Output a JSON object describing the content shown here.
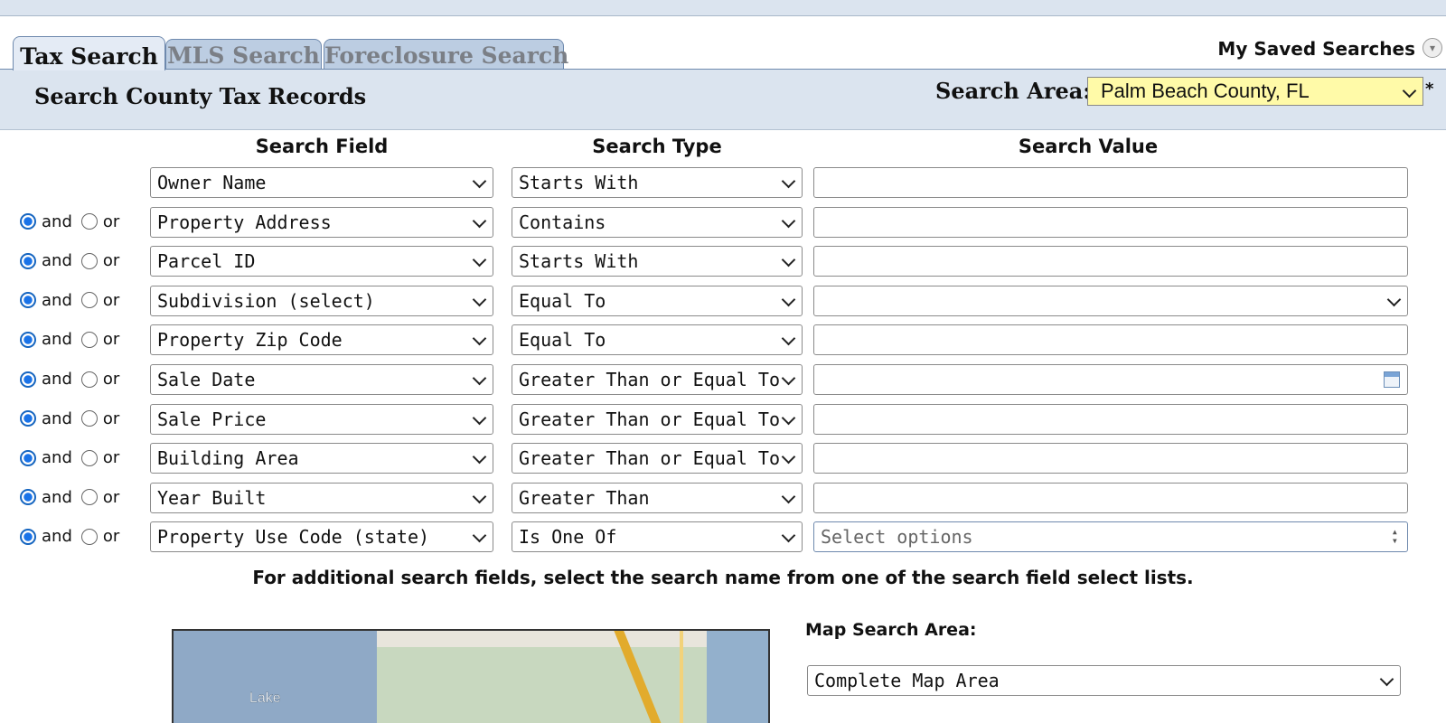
{
  "tabs": [
    {
      "label": "Tax Search",
      "active": true
    },
    {
      "label": "MLS Search",
      "active": false
    },
    {
      "label": "Foreclosure Search",
      "active": false
    }
  ],
  "saved_searches": "My Saved Searches",
  "section_title": "Search County Tax Records",
  "search_area": {
    "label": "Search Area:",
    "value": "Palm Beach County, FL",
    "required_mark": "*"
  },
  "headers": {
    "field": "Search Field",
    "type": "Search Type",
    "value": "Search Value"
  },
  "conj": {
    "and": "and",
    "or": "or"
  },
  "rows": [
    {
      "field": "Owner Name",
      "type": "Starts With",
      "value_kind": "text",
      "value": "",
      "has_conj": false
    },
    {
      "field": "Property Address",
      "type": "Contains",
      "value_kind": "text",
      "value": "",
      "has_conj": true,
      "and_selected": true
    },
    {
      "field": "Parcel ID",
      "type": "Starts With",
      "value_kind": "text",
      "value": "",
      "has_conj": true,
      "and_selected": true
    },
    {
      "field": "Subdivision (select)",
      "type": "Equal To",
      "value_kind": "select",
      "value": "",
      "has_conj": true,
      "and_selected": true
    },
    {
      "field": "Property Zip Code",
      "type": "Equal To",
      "value_kind": "text",
      "value": "",
      "has_conj": true,
      "and_selected": true
    },
    {
      "field": "Sale Date",
      "type": "Greater Than or Equal To",
      "value_kind": "date",
      "value": "",
      "has_conj": true,
      "and_selected": true
    },
    {
      "field": "Sale Price",
      "type": "Greater Than or Equal To",
      "value_kind": "text",
      "value": "",
      "has_conj": true,
      "and_selected": true
    },
    {
      "field": "Building Area",
      "type": "Greater Than or Equal To",
      "value_kind": "text",
      "value": "",
      "has_conj": true,
      "and_selected": true
    },
    {
      "field": "Year Built",
      "type": "Greater Than",
      "value_kind": "text",
      "value": "",
      "has_conj": true,
      "and_selected": true
    },
    {
      "field": "Property Use Code (state)",
      "type": "Is One Of",
      "value_kind": "multi",
      "value": "Select options",
      "has_conj": true,
      "and_selected": true
    }
  ],
  "note": "For additional search fields, select the search name from one of the search field select lists.",
  "map": {
    "label": "Map Search Area:",
    "select_value": "Complete Map Area",
    "place_label": "Lake"
  },
  "colors": {
    "band": "#dbe4ef",
    "search_area_bg": "#fffaa8",
    "tab_inactive": "#bccde2",
    "radio_on": "#1a73e8"
  }
}
